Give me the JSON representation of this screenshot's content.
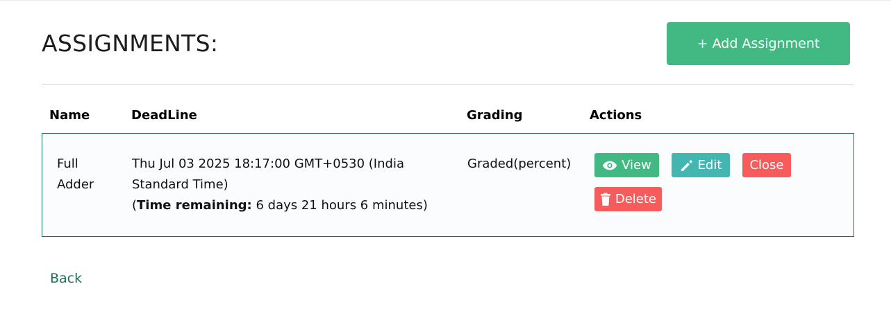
{
  "header": {
    "title": "ASSIGNMENTS:",
    "add_button_label": "+ Add Assignment"
  },
  "table": {
    "columns": [
      "Name",
      "DeadLine",
      "Grading",
      "Actions"
    ],
    "rows": [
      {
        "name_line1": "Full",
        "name_line2": "Adder",
        "deadline_line1": "Thu Jul 03 2025 18:17:00 GMT+0530 (India",
        "deadline_line2": "Standard Time)",
        "remaining_open": "(",
        "remaining_label": "Time remaining:",
        "remaining_value": " 6 days 21 hours 6 minutes)",
        "grading": "Graded(percent)",
        "actions": {
          "view": "View",
          "edit": "Edit",
          "close": "Close",
          "delete": "Delete"
        }
      }
    ]
  },
  "footer": {
    "back_label": "Back"
  },
  "icons": {
    "view": "eye-icon",
    "edit": "pencil-icon",
    "delete": "trash-icon"
  },
  "colors": {
    "primary_green": "#42b883",
    "teal": "#44b6b2",
    "danger_red": "#f65c5c",
    "border_green": "#1e6e56"
  }
}
